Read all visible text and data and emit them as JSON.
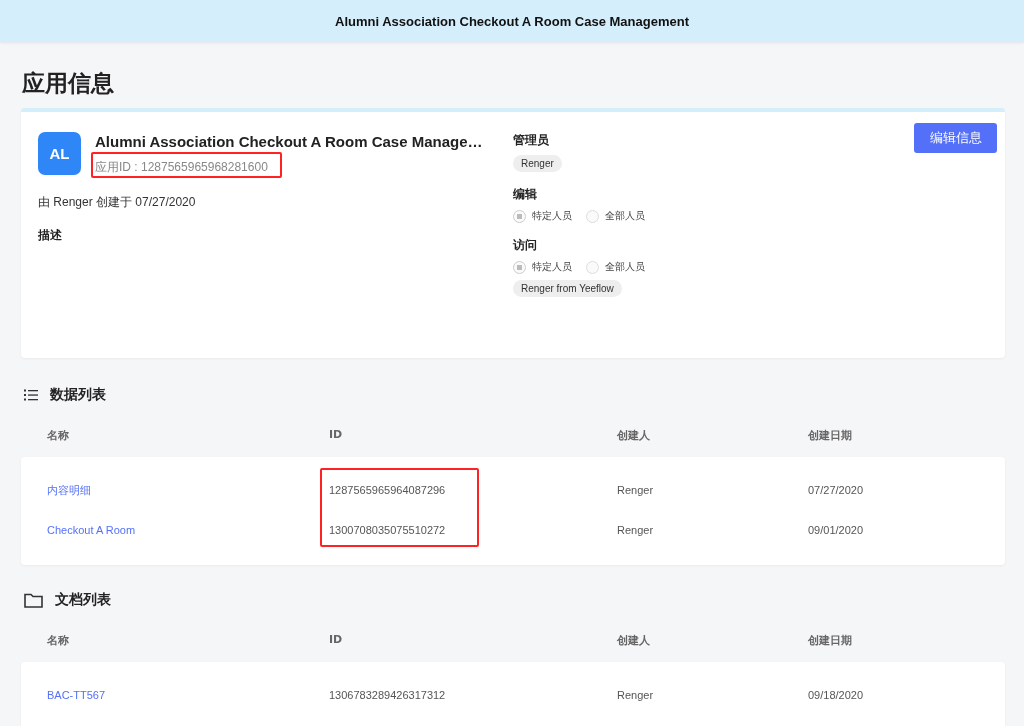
{
  "header": {
    "title": "Alumni Association Checkout A Room Case Management"
  },
  "page_title": "应用信息",
  "app": {
    "avatar": "AL",
    "name": "Alumni Association Checkout A Room Case Manage…",
    "app_id": "应用ID : 1287565965968281600",
    "created": "由 Renger 创建于 07/27/2020",
    "description_label": "描述",
    "edit_button": "编辑信息",
    "admin": {
      "label": "管理员",
      "tags": [
        "Renger"
      ]
    },
    "edit": {
      "label": "编辑",
      "options": [
        {
          "label": "特定人员",
          "selected": true
        },
        {
          "label": "全部人员",
          "selected": false
        }
      ]
    },
    "access": {
      "label": "访问",
      "options": [
        {
          "label": "特定人员",
          "selected": true
        },
        {
          "label": "全部人员",
          "selected": false
        }
      ],
      "tags": [
        "Renger from Yeeflow"
      ]
    }
  },
  "data_list": {
    "title": "数据列表",
    "columns": [
      "名称",
      "ID",
      "创建人",
      "创建日期"
    ],
    "rows": [
      {
        "name": "内容明细",
        "id": "1287565965964087296",
        "creator": "Renger",
        "date": "07/27/2020"
      },
      {
        "name": "Checkout A Room",
        "id": "1300708035075510272",
        "creator": "Renger",
        "date": "09/01/2020"
      }
    ]
  },
  "doc_list": {
    "title": "文档列表",
    "columns": [
      "名称",
      "ID",
      "创建人",
      "创建日期"
    ],
    "rows": [
      {
        "name": "BAC-TT567",
        "id": "1306783289426317312",
        "creator": "Renger",
        "date": "09/18/2020"
      }
    ]
  }
}
